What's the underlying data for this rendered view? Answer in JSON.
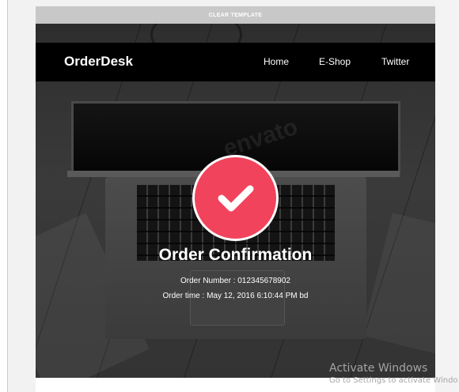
{
  "template_bar": {
    "label": "CLEAR TEMPLATE"
  },
  "header": {
    "brand": "OrderDesk",
    "nav": [
      "Home",
      "E-Shop",
      "Twitter"
    ]
  },
  "background": {
    "watermark": "envato"
  },
  "confirmation": {
    "icon": "check-mark-icon",
    "title": "Order Confirmation",
    "order_number": "Order Number : 012345678902",
    "order_time": "Order time : May 12, 2016 6:10:44 PM bd"
  },
  "system_overlay": {
    "title": "Activate Windows",
    "subtitle": "Go to Settings to activate Windo"
  },
  "colors": {
    "accent": "#f2435c",
    "header_bg": "#000000",
    "template_bar_bg": "#c8c8c8"
  }
}
